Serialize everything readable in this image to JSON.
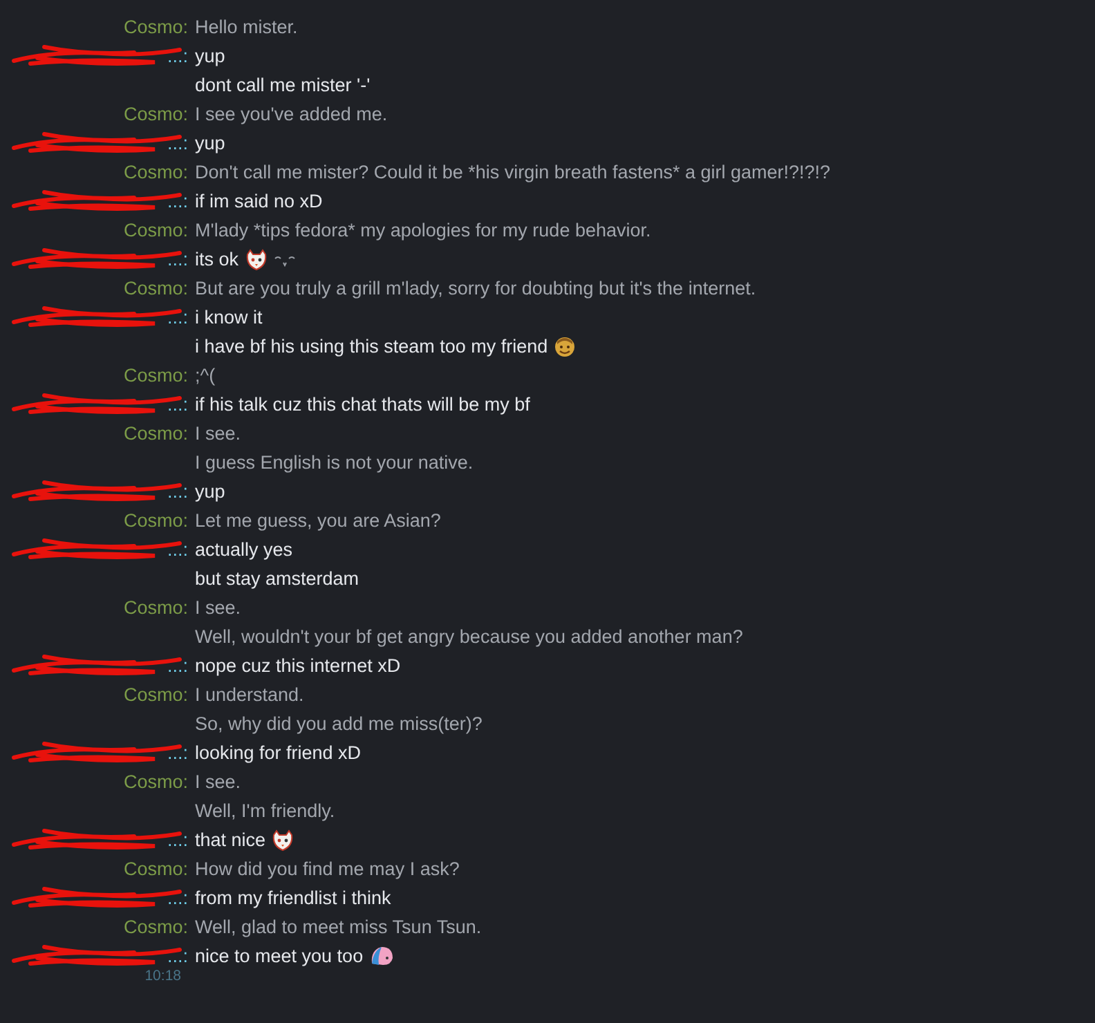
{
  "messages": [
    {
      "kind": "cosmo",
      "name": "Cosmo:",
      "lines": [
        {
          "text": "Hello mister."
        }
      ]
    },
    {
      "kind": "friend",
      "name": "...:",
      "redacted": true,
      "lines": [
        {
          "text": "yup"
        },
        {
          "text": "dont call me mister '-'"
        }
      ]
    },
    {
      "kind": "cosmo",
      "name": "Cosmo:",
      "lines": [
        {
          "text": "I see you've added me."
        }
      ]
    },
    {
      "kind": "friend",
      "name": "...:",
      "redacted": true,
      "lines": [
        {
          "text": "yup"
        }
      ]
    },
    {
      "kind": "cosmo",
      "name": "Cosmo:",
      "lines": [
        {
          "text": "Don't call me mister? Could it be *his virgin breath fastens* a girl gamer!?!?!?"
        }
      ]
    },
    {
      "kind": "friend",
      "name": "...:",
      "redacted": true,
      "lines": [
        {
          "text": "if im said no xD"
        }
      ]
    },
    {
      "kind": "cosmo",
      "name": "Cosmo:",
      "lines": [
        {
          "text": "M'lady *tips fedora* my apologies for my rude behavior."
        }
      ]
    },
    {
      "kind": "friend",
      "name": "...:",
      "redacted": true,
      "lines": [
        {
          "text": "its ok",
          "emoticons": [
            {
              "kind": "cat"
            },
            {
              "kind": "squiggle"
            }
          ]
        }
      ]
    },
    {
      "kind": "cosmo",
      "name": "Cosmo:",
      "lines": [
        {
          "text": "But are you truly a grill m'lady, sorry for doubting but it's the internet."
        }
      ]
    },
    {
      "kind": "friend",
      "name": "...:",
      "redacted": true,
      "lines": [
        {
          "text": "i know it"
        },
        {
          "text": "i have bf his using this steam too my friend",
          "emoticons": [
            {
              "kind": "gold"
            }
          ]
        }
      ]
    },
    {
      "kind": "cosmo",
      "name": "Cosmo:",
      "lines": [
        {
          "text": ";^("
        }
      ]
    },
    {
      "kind": "friend",
      "name": "...:",
      "redacted": true,
      "lines": [
        {
          "text": "if his talk cuz this chat thats will be my bf"
        }
      ]
    },
    {
      "kind": "cosmo",
      "name": "Cosmo:",
      "lines": [
        {
          "text": "I see."
        },
        {
          "text": "I guess English is not your native."
        }
      ]
    },
    {
      "kind": "friend",
      "name": "...:",
      "redacted": true,
      "lines": [
        {
          "text": "yup"
        }
      ]
    },
    {
      "kind": "cosmo",
      "name": "Cosmo:",
      "lines": [
        {
          "text": "Let me guess, you are Asian?"
        }
      ]
    },
    {
      "kind": "friend",
      "name": "...:",
      "redacted": true,
      "lines": [
        {
          "text": "actually yes"
        },
        {
          "text": "but stay amsterdam"
        }
      ]
    },
    {
      "kind": "cosmo",
      "name": "Cosmo:",
      "lines": [
        {
          "text": "I see."
        },
        {
          "text": "Well, wouldn't your bf get angry because you added another man?"
        }
      ]
    },
    {
      "kind": "friend",
      "name": "...:",
      "redacted": true,
      "lines": [
        {
          "text": "nope cuz this internet xD"
        }
      ]
    },
    {
      "kind": "cosmo",
      "name": "Cosmo:",
      "lines": [
        {
          "text": "I understand."
        },
        {
          "text": "So, why did you add me miss(ter)?"
        }
      ]
    },
    {
      "kind": "friend",
      "name": "...:",
      "redacted": true,
      "lines": [
        {
          "text": "looking for friend xD"
        }
      ]
    },
    {
      "kind": "cosmo",
      "name": "Cosmo:",
      "lines": [
        {
          "text": "I see."
        },
        {
          "text": "Well, I'm friendly."
        }
      ]
    },
    {
      "kind": "friend",
      "name": "...:",
      "redacted": true,
      "lines": [
        {
          "text": "that nice",
          "emoticons": [
            {
              "kind": "cat"
            }
          ]
        }
      ]
    },
    {
      "kind": "cosmo",
      "name": "Cosmo:",
      "lines": [
        {
          "text": "How did you find me may I ask?"
        }
      ]
    },
    {
      "kind": "friend",
      "name": "...:",
      "redacted": true,
      "lines": [
        {
          "text": "from my friendlist i think"
        }
      ]
    },
    {
      "kind": "cosmo",
      "name": "Cosmo:",
      "lines": [
        {
          "text": "Well, glad to meet miss Tsun Tsun."
        }
      ]
    },
    {
      "kind": "friend",
      "name": "...:",
      "redacted": true,
      "lines": [
        {
          "text": "nice to meet you too",
          "emoticons": [
            {
              "kind": "character"
            }
          ]
        }
      ]
    }
  ],
  "timestamp": "10:18"
}
